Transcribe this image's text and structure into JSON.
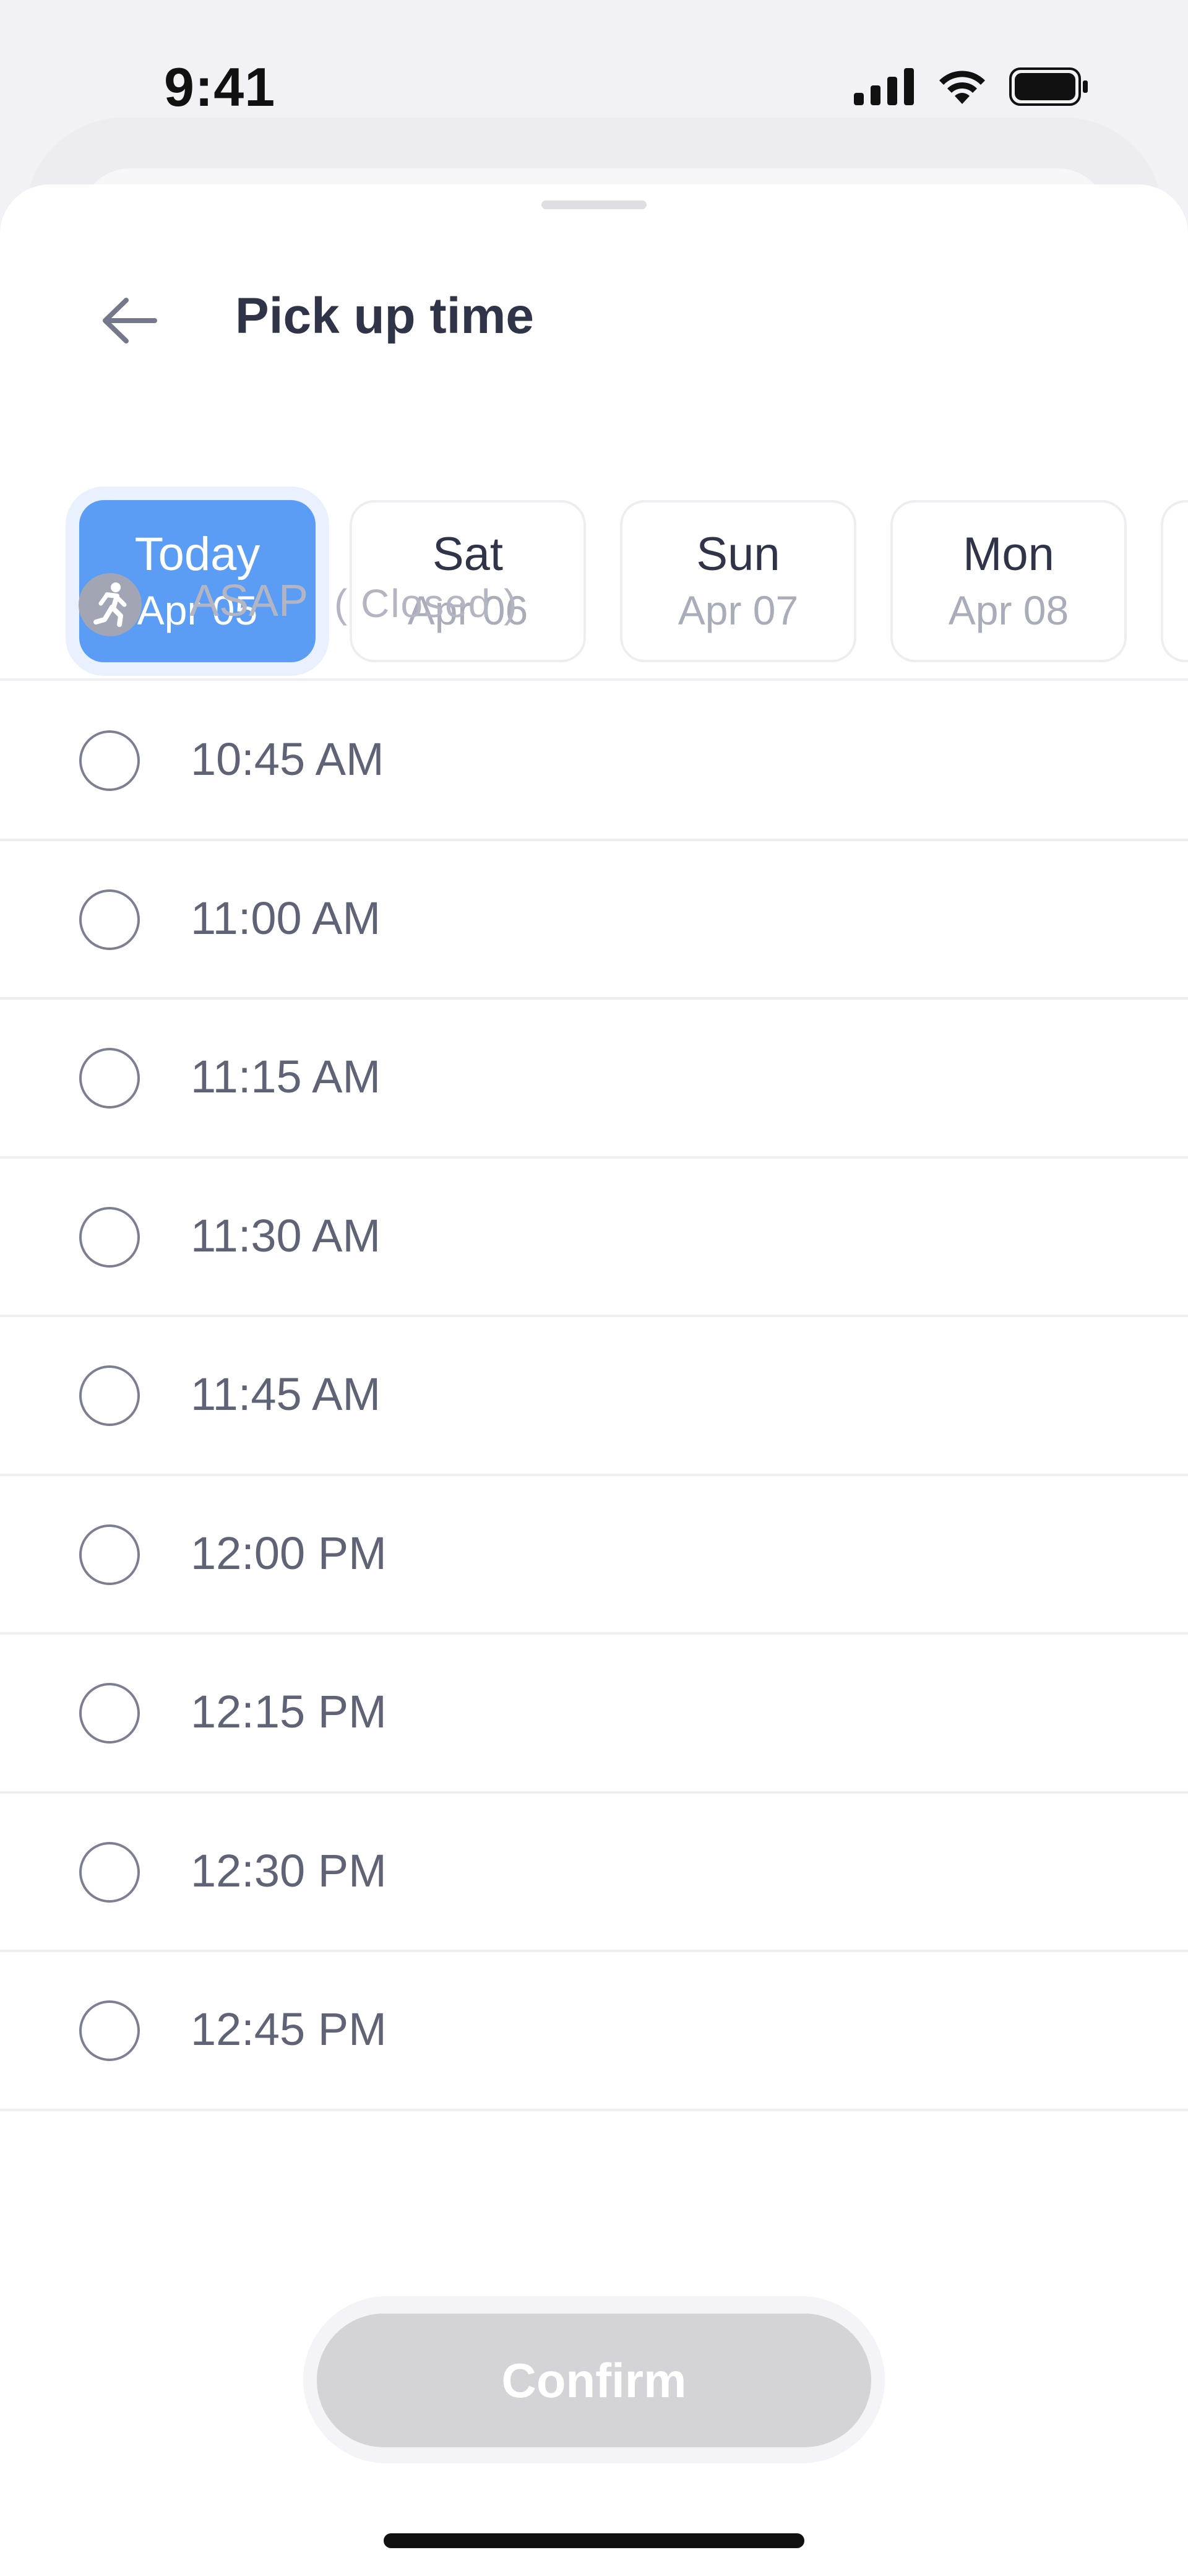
{
  "status_bar": {
    "time": "9:41"
  },
  "header": {
    "title": "Pick up time"
  },
  "dates": [
    {
      "day": "Today",
      "date": "Apr 05",
      "selected": true
    },
    {
      "day": "Sat",
      "date": "Apr 06",
      "selected": false
    },
    {
      "day": "Sun",
      "date": "Apr 07",
      "selected": false
    },
    {
      "day": "Mon",
      "date": "Apr 08",
      "selected": false
    }
  ],
  "asap": {
    "label": "ASAP",
    "status": "( Closed )"
  },
  "time_slots": [
    "10:45 AM",
    "11:00 AM",
    "11:15 AM",
    "11:30 AM",
    "11:45 AM",
    "12:00 PM",
    "12:15 PM",
    "12:30 PM",
    "12:45 PM"
  ],
  "confirm": {
    "label": "Confirm"
  },
  "colors": {
    "accent": "#5b9cf5",
    "title_text": "#2f3448",
    "slot_text": "#5f6376",
    "disabled_button": "#d3d3d8"
  }
}
